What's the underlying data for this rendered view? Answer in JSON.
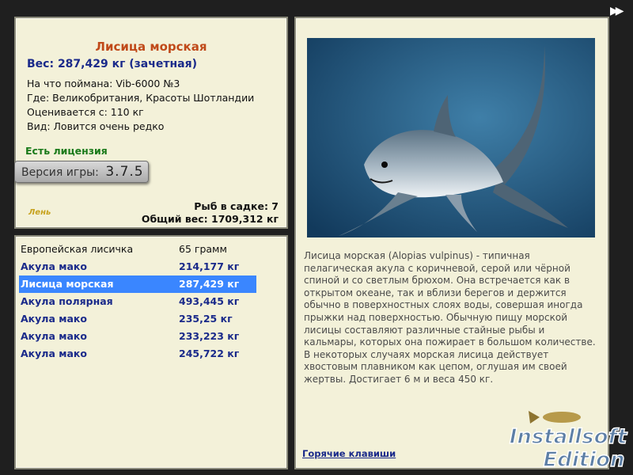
{
  "fish": {
    "title": "Лисица морская",
    "weight": "Вес: 287,429 кг (зачетная)",
    "caught_with": "На что поймана: Vib-6000 №3",
    "location": "Где: Великобритания, Красоты Шотландии",
    "estimate": "Оценивается с: 110 кг",
    "rarity": "Вид: Ловится очень редко"
  },
  "license_text": "Есть лицензия",
  "version": {
    "label": "Версия игры:",
    "number": "3.7.5"
  },
  "logo_text": "Лень",
  "tank": {
    "count": "Рыб в садке: 7",
    "total": "Общий вес: 1709,312 кг"
  },
  "catches": [
    {
      "name": "Европейская лисичка",
      "weight": "65 грамм"
    },
    {
      "name": "Акула мако",
      "weight": "214,177 кг"
    },
    {
      "name": "Лисица морская",
      "weight": "287,429 кг"
    },
    {
      "name": "Акула полярная",
      "weight": "493,445 кг"
    },
    {
      "name": "Акула мако",
      "weight": "235,25 кг"
    },
    {
      "name": "Акула мако",
      "weight": "233,223 кг"
    },
    {
      "name": "Акула мако",
      "weight": "245,722 кг"
    }
  ],
  "description": "Лисица морская (Alopias vulpinus) - типичная пелагическая акула с коричневой, серой или чёрной спиной и со светлым брюхом. Она встречается как в открытом океане, так и вблизи берегов и держится обычно в поверхностных слоях воды, совершая иногда прыжки над поверхностью. Обычную пищу морской лисицы составляют различные стайные рыбы и кальмары, которых она пожирает в большом количестве. В некоторых случаях морская лисица действует хвостовым плавником как цепом, оглушая им своей жертвы. Достигает 6 м и веса 450 кг.",
  "hotkeys": "Горячие клавиши",
  "next_icon": "fast-forward-icon",
  "watermark": {
    "line1": "Installsoft",
    "line2": "Edition"
  }
}
